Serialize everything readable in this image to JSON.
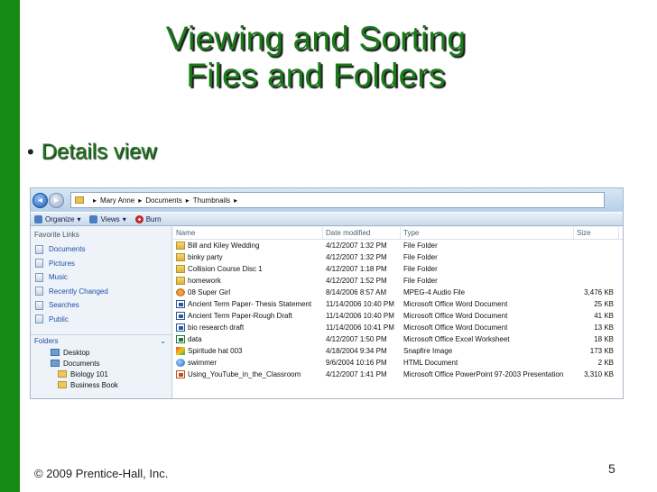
{
  "slide": {
    "title_line1": "Viewing and Sorting",
    "title_line2": "Files and Folders",
    "bullet": "Details view",
    "footer": "© 2009 Prentice-Hall, Inc.",
    "page_number": "5",
    "accent_color": "#168c16"
  },
  "explorer": {
    "address": {
      "crumbs": [
        "Mary Anne",
        "Documents",
        "Thumbnails"
      ],
      "separator": "▸"
    },
    "toolbar": {
      "organize": "Organize",
      "views": "Views",
      "burn": "Burn",
      "dropdown": "▾"
    },
    "favorites_title": "Favorite Links",
    "favorites": [
      "Documents",
      "Pictures",
      "Music",
      "Recently Changed",
      "Searches",
      "Public"
    ],
    "folders_title": "Folders",
    "folders_toggle": "⌄",
    "tree": [
      {
        "label": "Desktop",
        "icon": "blue"
      },
      {
        "label": "Documents",
        "icon": "blue"
      },
      {
        "label": "Biology 101",
        "icon": "yellow"
      },
      {
        "label": "Business Book",
        "icon": "yellow"
      }
    ],
    "columns": {
      "name": "Name",
      "date": "Date modified",
      "type": "Type",
      "size": "Size"
    },
    "files": [
      {
        "name": "Bill and Kiley Wedding",
        "date": "4/12/2007 1:32 PM",
        "type": "File Folder",
        "size": "",
        "icon": "folder"
      },
      {
        "name": "binky party",
        "date": "4/12/2007 1:32 PM",
        "type": "File Folder",
        "size": "",
        "icon": "folder"
      },
      {
        "name": "Collision Course Disc 1",
        "date": "4/12/2007 1:18 PM",
        "type": "File Folder",
        "size": "",
        "icon": "folder"
      },
      {
        "name": "homework",
        "date": "4/12/2007 1:52 PM",
        "type": "File Folder",
        "size": "",
        "icon": "folder"
      },
      {
        "name": "08 Super Girl",
        "date": "8/14/2006 8:57 AM",
        "type": "MPEG-4 Audio File",
        "size": "3,476 KB",
        "icon": "audio"
      },
      {
        "name": "Ancient Term Paper- Thesis Statement",
        "date": "11/14/2006 10:40 PM",
        "type": "Microsoft Office Word Document",
        "size": "25 KB",
        "icon": "word"
      },
      {
        "name": "Ancient Term Paper-Rough Draft",
        "date": "11/14/2006 10:40 PM",
        "type": "Microsoft Office Word Document",
        "size": "41 KB",
        "icon": "word"
      },
      {
        "name": "bio research draft",
        "date": "11/14/2006 10:41 PM",
        "type": "Microsoft Office Word Document",
        "size": "13 KB",
        "icon": "word"
      },
      {
        "name": "data",
        "date": "4/12/2007 1:50 PM",
        "type": "Microsoft Office Excel Worksheet",
        "size": "18 KB",
        "icon": "excel"
      },
      {
        "name": "Spiritude hat 003",
        "date": "4/18/2004 9:34 PM",
        "type": "Snapfire Image",
        "size": "173 KB",
        "icon": "snap"
      },
      {
        "name": "swimmer",
        "date": "9/6/2004 10:16 PM",
        "type": "HTML Document",
        "size": "2 KB",
        "icon": "html"
      },
      {
        "name": "Using_YouTube_in_the_Classroom",
        "date": "4/12/2007 1:41 PM",
        "type": "Microsoft Office PowerPoint 97-2003 Presentation",
        "size": "3,310 KB",
        "icon": "ppt"
      }
    ]
  }
}
